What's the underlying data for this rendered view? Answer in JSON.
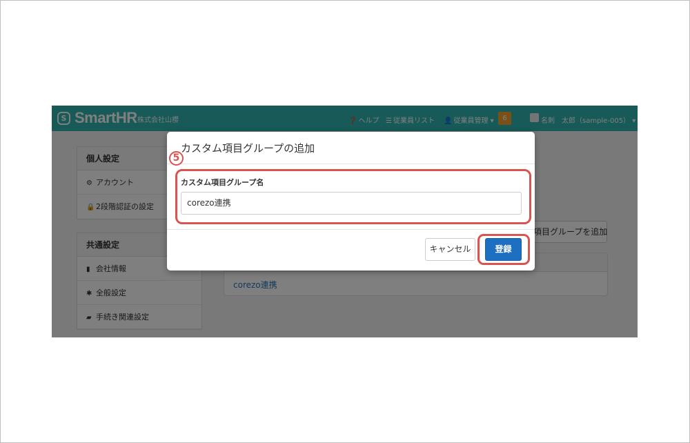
{
  "header": {
    "logo_text": "SmartHR",
    "company": "株式会社山櫻",
    "nav": [
      {
        "icon": "help-icon",
        "label": "ヘルプ"
      },
      {
        "icon": "list-icon",
        "label": "従業員リスト"
      },
      {
        "icon": "person-icon",
        "label": "従業員管理"
      }
    ],
    "notification_count": "6",
    "user_name": "名刺　太郎（sample-005）"
  },
  "sidebar": {
    "personal": {
      "title": "個人設定",
      "items": [
        {
          "icon": "gear-icon",
          "label": "アカウント"
        },
        {
          "icon": "lock-icon",
          "label": "2段階認証の設定"
        }
      ]
    },
    "common": {
      "title": "共通設定",
      "items": [
        {
          "icon": "building-icon",
          "label": "会社情報"
        },
        {
          "icon": "asterisk-icon",
          "label": "全般設定"
        },
        {
          "icon": "book-icon",
          "label": "手続き関連設定"
        }
      ]
    }
  },
  "main": {
    "add_group_button": "項目グループを追加",
    "table_rows": [
      "corezo連携"
    ]
  },
  "modal": {
    "title": "カスタム項目グループの追加",
    "step_number": "5",
    "field_label": "カスタム項目グループ名",
    "field_value": "corezo連携",
    "cancel_label": "キャンセル",
    "submit_label": "登録"
  },
  "colors": {
    "header": "#2fb5b0",
    "highlight": "#d9534f",
    "primary_button": "#1c6fc1"
  }
}
